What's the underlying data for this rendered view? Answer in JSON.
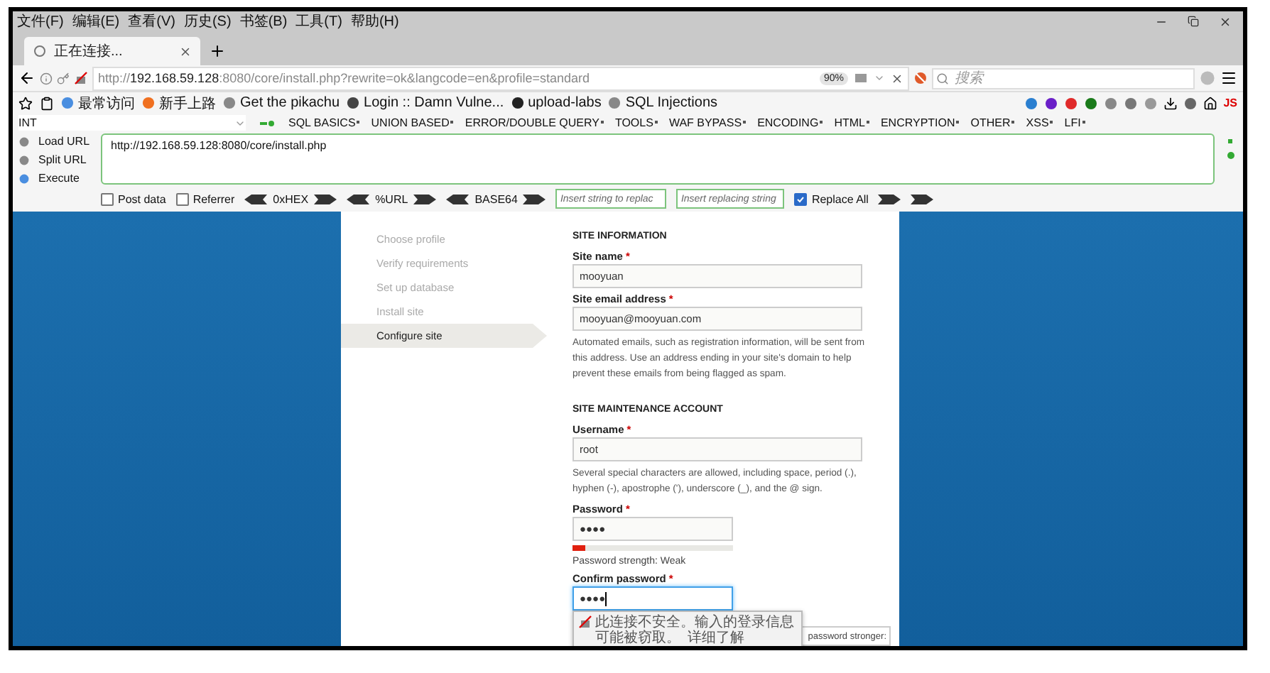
{
  "menu_bar": [
    "文件(F)",
    "编辑(E)",
    "查看(V)",
    "历史(S)",
    "书签(B)",
    "工具(T)",
    "帮助(H)"
  ],
  "tabs": [
    {
      "title": "正在连接...",
      "selected": true
    }
  ],
  "address_bar": {
    "scheme": "http://",
    "host": "192.168.59.128",
    "path": ":8080/core/install.php?rewrite=ok&langcode=en&profile=standard",
    "zoom": "90%"
  },
  "search": {
    "placeholder": "搜索"
  },
  "bookmarks": [
    "最常访问",
    "新手上路",
    "Get the pikachu",
    "Login :: Damn Vulne...",
    "upload-labs",
    "SQL Injections"
  ],
  "addon_badge": "JS",
  "hackbar": {
    "encoding": "INT",
    "menus": [
      "SQL BASICS",
      "UNION BASED",
      "ERROR/DOUBLE QUERY",
      "TOOLS",
      "WAF BYPASS",
      "ENCODING",
      "HTML",
      "ENCRYPTION",
      "OTHER",
      "XSS",
      "LFI"
    ],
    "actions": [
      "Load URL",
      "Split URL",
      "Execute"
    ],
    "url": "http://192.168.59.128:8080/core/install.php",
    "options": [
      {
        "label": "Post data",
        "checked": false
      },
      {
        "label": "Referrer",
        "checked": false
      }
    ],
    "encoders": [
      "0xHEX",
      "%URL",
      "BASE64"
    ],
    "find_placeholder": "Insert string to replac",
    "replace_placeholder": "Insert replacing string",
    "replace_all": {
      "label": "Replace All",
      "checked": true
    }
  },
  "installer": {
    "steps": [
      {
        "label": "Choose profile",
        "selected": false
      },
      {
        "label": "Verify requirements",
        "selected": false
      },
      {
        "label": "Set up database",
        "selected": false
      },
      {
        "label": "Install site",
        "selected": false
      },
      {
        "label": "Configure site",
        "selected": true
      }
    ],
    "form": [
      {
        "kind": "heading",
        "text": "SITE INFORMATION"
      },
      {
        "kind": "field",
        "label": "Site name",
        "required_mark": "*",
        "value": "mooyuan",
        "focused": false
      },
      {
        "kind": "field",
        "label": "Site email address",
        "required_mark": "*",
        "value": "mooyuan@mooyuan.com",
        "focused": false,
        "help": "Automated emails, such as registration information, will be sent from this address. Use an address ending in your site's domain to help prevent these emails from being flagged as spam."
      },
      {
        "kind": "heading",
        "text": "SITE MAINTENANCE ACCOUNT"
      },
      {
        "kind": "field",
        "label": "Username",
        "required_mark": "*",
        "value": "root",
        "focused": false,
        "help": "Several special characters are allowed, including space, period (.), hyphen (-), apostrophe ('), underscore (_), and the @ sign."
      },
      {
        "kind": "password",
        "label": "Password",
        "required_mark": "*",
        "value": "●●●●",
        "focused": false,
        "level": 0.08,
        "strength": "Password strength: Weak"
      },
      {
        "kind": "password",
        "label": "Confirm password",
        "required_mark": "*",
        "value": "●●●●",
        "focused": true
      }
    ],
    "hint_box": "password stronger:",
    "insecure_popup": {
      "text": "此连接不安全。输入的登录信息可能被窃取。",
      "link": "详细了解"
    }
  }
}
